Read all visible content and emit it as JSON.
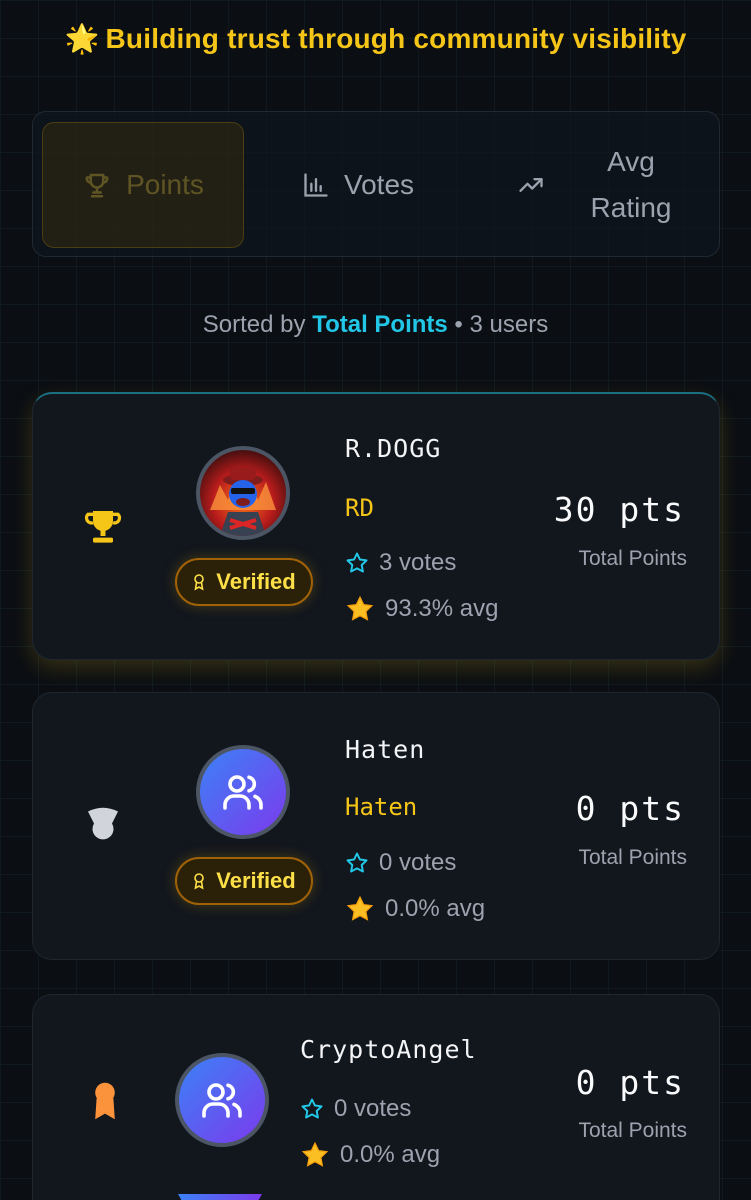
{
  "header": {
    "spark_icon": "🌟",
    "tagline": "Building trust through community visibility"
  },
  "tabs": [
    {
      "label": "Points",
      "icon": "trophy-icon",
      "active": true
    },
    {
      "label": "Votes",
      "icon": "bar-chart-icon",
      "active": false
    },
    {
      "label_line1": "Avg",
      "label_line2": "Rating",
      "icon": "trending-up-icon",
      "active": false
    }
  ],
  "sort": {
    "prefix": "Sorted by",
    "key": "Total Points",
    "suffix": "• 3 users"
  },
  "users": [
    {
      "rank_icon": "gold-trophy-icon",
      "name": "R.DOGG",
      "handle": "RD",
      "verified": "Verified",
      "votes": "3 votes",
      "avg": "93.3% avg",
      "points": "30 pts",
      "points_label": "Total Points"
    },
    {
      "rank_icon": "silver-medal-icon",
      "name": "Haten",
      "handle": "Haten",
      "verified": "Verified",
      "votes": "0 votes",
      "avg": "0.0% avg",
      "points": "0 pts",
      "points_label": "Total Points"
    },
    {
      "rank_icon": "bronze-award-icon",
      "name": "CryptoAngel",
      "votes": "0 votes",
      "avg": "0.0% avg",
      "points": "0 pts",
      "points_label": "Total Points"
    }
  ],
  "colors": {
    "accent_gold": "#f5c518",
    "accent_cyan": "#22c7e8",
    "background": "#0b0e13",
    "card": "#12161d"
  }
}
